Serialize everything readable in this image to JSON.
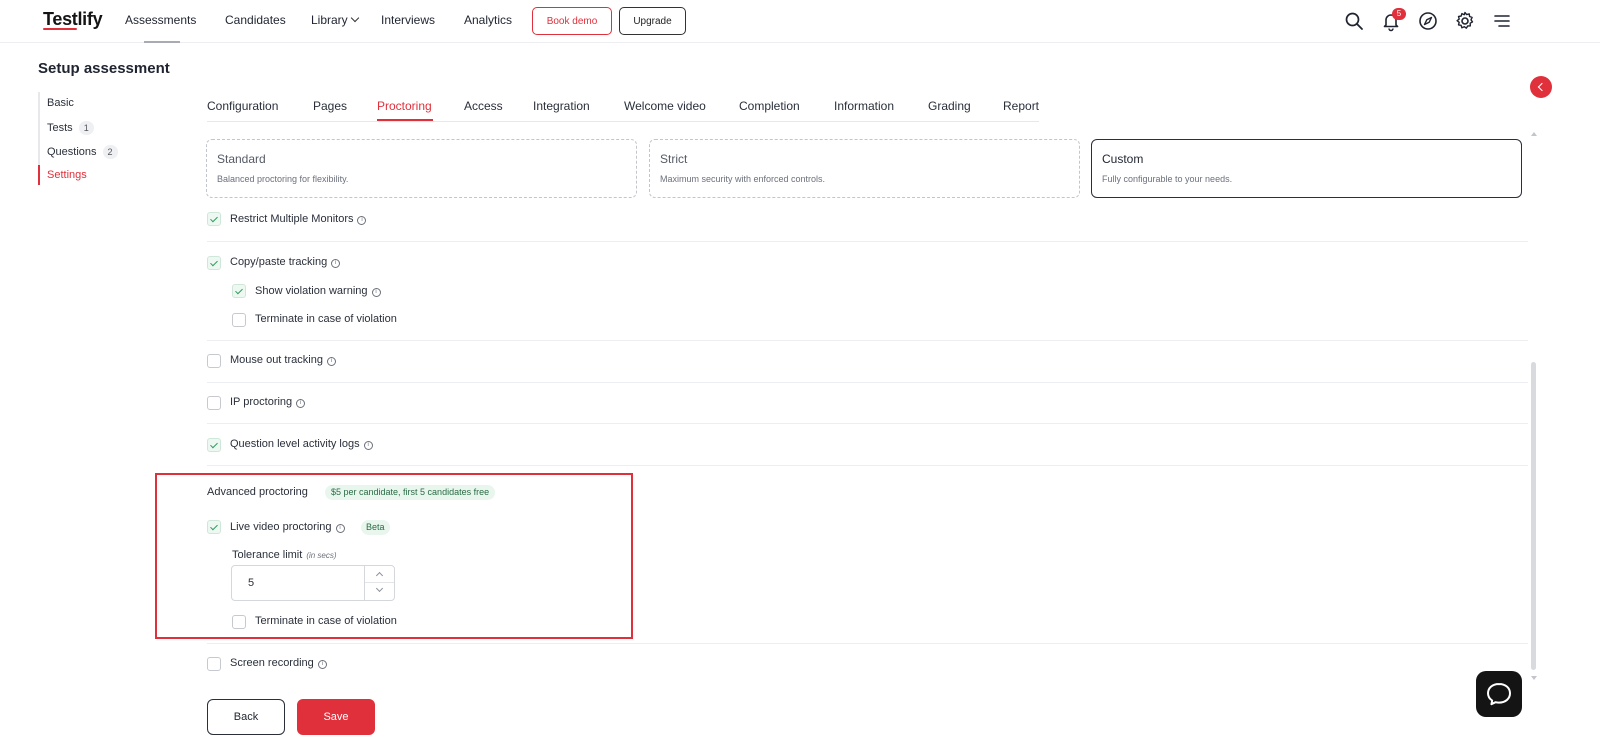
{
  "header": {
    "logo": "Testlify",
    "nav": [
      {
        "label": "Assessments"
      },
      {
        "label": "Candidates"
      },
      {
        "label": "Library"
      },
      {
        "label": "Interviews"
      },
      {
        "label": "Analytics"
      }
    ],
    "book_demo": "Book demo",
    "upgrade": "Upgrade",
    "notification_count": "5",
    "icons": [
      "search-icon",
      "bell-icon",
      "compass-icon",
      "gear-icon",
      "menu-icon"
    ]
  },
  "page": {
    "title": "Setup assessment"
  },
  "sidebar": {
    "items": [
      {
        "label": "Basic",
        "count": ""
      },
      {
        "label": "Tests",
        "count": "1"
      },
      {
        "label": "Questions",
        "count": "2"
      },
      {
        "label": "Settings",
        "count": ""
      }
    ]
  },
  "tabs": [
    {
      "label": "Configuration"
    },
    {
      "label": "Pages"
    },
    {
      "label": "Proctoring"
    },
    {
      "label": "Access"
    },
    {
      "label": "Integration"
    },
    {
      "label": "Welcome video"
    },
    {
      "label": "Completion"
    },
    {
      "label": "Information"
    },
    {
      "label": "Grading"
    },
    {
      "label": "Report"
    }
  ],
  "modes": [
    {
      "title": "Standard",
      "desc": "Balanced proctoring for flexibility."
    },
    {
      "title": "Strict",
      "desc": "Maximum security with enforced controls."
    },
    {
      "title": "Custom",
      "desc": "Fully configurable to your needs."
    }
  ],
  "options": {
    "restrict_monitors": {
      "label": "Restrict Multiple Monitors",
      "checked": true
    },
    "copy_paste": {
      "label": "Copy/paste tracking",
      "checked": true
    },
    "show_warning": {
      "label": "Show violation warning",
      "checked": true
    },
    "terminate_copy": {
      "label": "Terminate in case of violation",
      "checked": false
    },
    "mouse_out": {
      "label": "Mouse out tracking",
      "checked": false
    },
    "ip_proctoring": {
      "label": "IP proctoring",
      "checked": false
    },
    "activity_logs": {
      "label": "Question level activity logs",
      "checked": true
    },
    "screen_recording": {
      "label": "Screen recording",
      "checked": false
    }
  },
  "advanced": {
    "title": "Advanced proctoring",
    "price": "$5 per candidate, first 5 candidates free",
    "live_video": {
      "label": "Live video proctoring",
      "checked": true,
      "badge": "Beta"
    },
    "tolerance_label": "Tolerance limit",
    "tolerance_unit": "(in secs)",
    "tolerance_value": "5",
    "terminate": {
      "label": "Terminate in case of violation",
      "checked": false
    }
  },
  "footer": {
    "back": "Back",
    "save": "Save"
  },
  "info_glyph": "i",
  "colors": {
    "accent": "#e0303b",
    "success": "#2f9e5b"
  }
}
